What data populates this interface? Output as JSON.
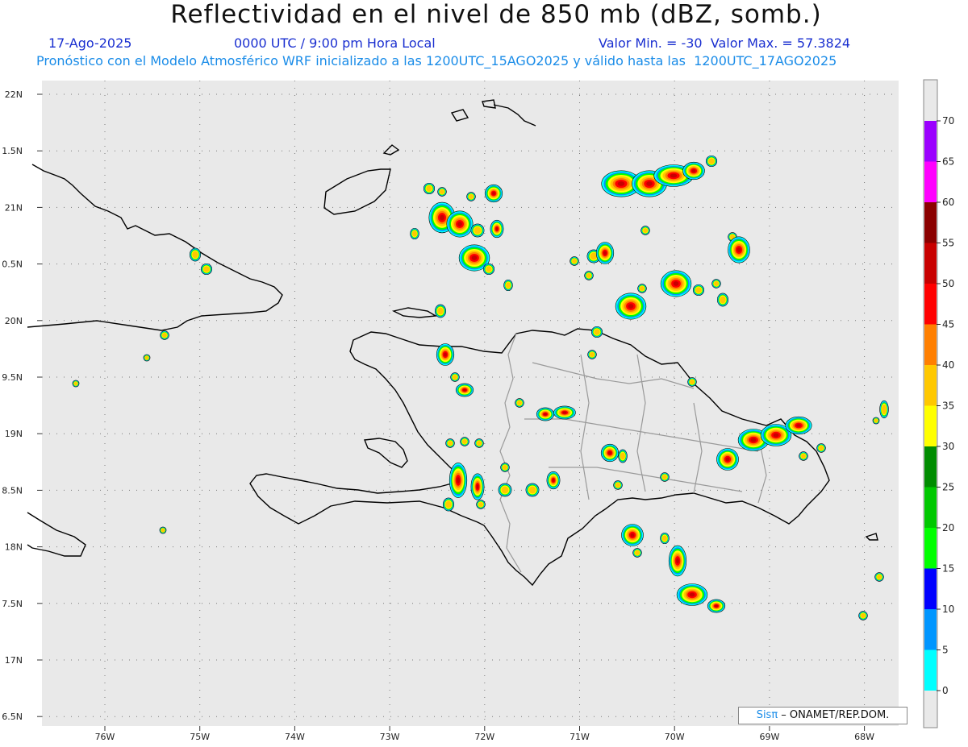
{
  "title": "Reflectividad en el nivel de 850 mb (dBZ, somb.)",
  "date": "17-Ago-2025",
  "time": "0000 UTC / 9:00 pm Hora Local",
  "minmax": "Valor Min. = -30  Valor Max. = 57.3824",
  "forecast_note": "Pronóstico con el Modelo Atmosférico WRF inicializado a las 1200UTC_15AGO2025 y válido hasta las  1200UTC_17AGO2025",
  "credit": {
    "sis": "Sisπ",
    "rest": " – ONAMET/REP.DOM."
  },
  "lat_labels": [
    "22N",
    "1.5N",
    "21N",
    "0.5N",
    "20N",
    "9.5N",
    "19N",
    "8.5N",
    "18N",
    "7.5N",
    "17N",
    "6.5N"
  ],
  "lon_labels": [
    "76W",
    "75W",
    "74W",
    "73W",
    "72W",
    "71W",
    "70W",
    "69W",
    "68W"
  ],
  "colorbar": {
    "labels": [
      "70",
      "65",
      "60",
      "55",
      "50",
      "45",
      "40",
      "35",
      "30",
      "25",
      "20",
      "15",
      "10",
      "5",
      "0"
    ],
    "colors": [
      "#9b00ff",
      "#ff00ff",
      "#8b0000",
      "#c80000",
      "#ff0000",
      "#ff7f00",
      "#ffc800",
      "#ffff00",
      "#008c00",
      "#00c800",
      "#00ff00",
      "#0000ff",
      "#0096ff",
      "#00ffff"
    ]
  },
  "colors": {
    "land_bg": "#e9e9e9",
    "grid": "#7a7a7a",
    "coast": "#000000",
    "border": "#999999"
  }
}
